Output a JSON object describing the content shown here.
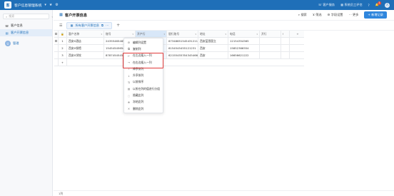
{
  "app": {
    "title": "客户信息管理系统",
    "logo": "客"
  },
  "topbar": {
    "items": [
      "客户服务",
      "系统员工评估",
      "消息"
    ],
    "notif_count": "1",
    "avatar": "人"
  },
  "sidebar": {
    "search_placeholder": "搜索",
    "items": [
      {
        "label": "客户信息",
        "active": false
      },
      {
        "label": "客户开票信息",
        "active": true
      }
    ],
    "user": {
      "initial": "U",
      "name": "管理"
    }
  },
  "main": {
    "title": "客户开票信息",
    "tools": [
      "搜索",
      "筛选",
      "字段设置",
      "更多"
    ],
    "add_label": "+ 新增记录"
  },
  "view": {
    "tab_label": "所有客户开票信息",
    "add": "+"
  },
  "grid": {
    "columns": [
      "客户名称",
      "账号",
      "开户行",
      "银行账号",
      "地址",
      "电话",
      "开行",
      "!"
    ],
    "rows": [
      {
        "num": "1",
        "name": "西安X酒店",
        "account": "24355465465",
        "open_bank": "",
        "bank_no": "6734885154543121145",
        "addr": "西安蓝思国立",
        "phone": "12154354565",
        "rcv": ""
      },
      {
        "num": "2",
        "name": "西安X餐馆",
        "account": "15454545654",
        "open_bank": "",
        "bank_no": "6154545455121231",
        "addr": "西安",
        "phone": "15852366554",
        "rcv": ""
      },
      {
        "num": "3",
        "name": "西安X学校",
        "account": "87874545454",
        "open_bank": "",
        "bank_no": "62155455354345466",
        "addr": "西安",
        "phone": "16656621222",
        "rcv": ""
      }
    ],
    "add_row": "+"
  },
  "context_menu": {
    "items": [
      {
        "icon": "⚙",
        "label": "编辑列设置"
      },
      {
        "icon": "⧉",
        "label": "复制列"
      },
      {
        "icon": "←",
        "label": "在左边插入一列"
      },
      {
        "icon": "→",
        "label": "在右边插入一列"
      },
      {
        "icon": "↑",
        "label": "降序排列"
      },
      {
        "icon": "↓",
        "label": "升序排列"
      },
      {
        "icon": "⇅",
        "label": "以前排序"
      },
      {
        "icon": "▤",
        "label": "以所在列的值进行分组"
      },
      {
        "icon": "◌",
        "label": "隐藏此列"
      },
      {
        "icon": "❄",
        "label": "冻结此列"
      },
      {
        "icon": "✕",
        "label": "删除此列"
      }
    ]
  },
  "footer": {
    "text": "1列"
  },
  "colors": {
    "topbar": "#1f6fb8",
    "accent": "#2f86dd",
    "highlight_border": "#e03a3a"
  }
}
